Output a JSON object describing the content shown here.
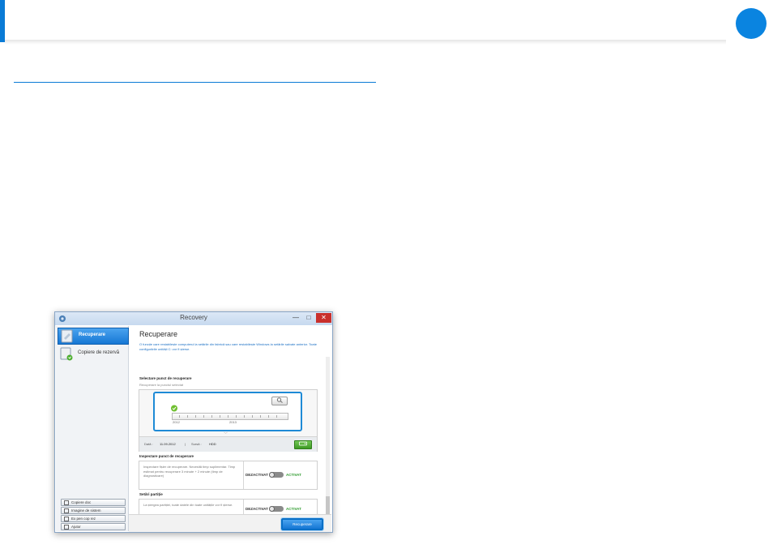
{
  "window": {
    "title": "Recovery",
    "minimize": "—",
    "maximize": "□",
    "close": "✕"
  },
  "sidebar": {
    "items": [
      {
        "label": "Recuperare",
        "icon": "drive-restore-icon",
        "active": true
      },
      {
        "label": "Copiere de rezervă",
        "icon": "drive-backup-icon",
        "active": false
      }
    ],
    "buttons": [
      {
        "label": "Copiere doc"
      },
      {
        "label": "Imagine de sistem"
      },
      {
        "label": "Ex pen cop rez"
      },
      {
        "label": "Ajutor"
      }
    ]
  },
  "main": {
    "title": "Recuperare",
    "description": "O funcție care restabilește computerul la setările din fabrică sau care restabilește Windows la setările salvate anterior. Toate configurările unității C: vor fi șterse.",
    "select_section": {
      "label": "Selectare punct de recuperare",
      "sublabel": "Recuperare la punctul selectat",
      "years": [
        "2012",
        "2013"
      ],
      "info": {
        "date_label": "Dată :",
        "date_value": "11.09.2012",
        "separator": "|",
        "source_label": "Sursă :",
        "source_value": "HDD"
      }
    },
    "inspect_section": {
      "label": "Inspectare punct de recuperare",
      "text": "Inspectare fișier de recuperare. Necesită timp suplimentar. Timp estimat pentru recuperare 3 minute + 2 minute (timp de diagnosticare)",
      "off_label": "DEZACTIVAT",
      "on_label": "ACTIVAT"
    },
    "partition_section": {
      "label": "Setări partiție",
      "text": "La ștergea partiției, toate datele din toate unitățile vor fi șterse.",
      "off_label": "DEZACTIVAT",
      "on_label": "ACTIVAT"
    },
    "recover_button": "Recuperare"
  },
  "colors": {
    "accent_blue": "#0a84e0",
    "active_green": "#2e9b2e"
  }
}
